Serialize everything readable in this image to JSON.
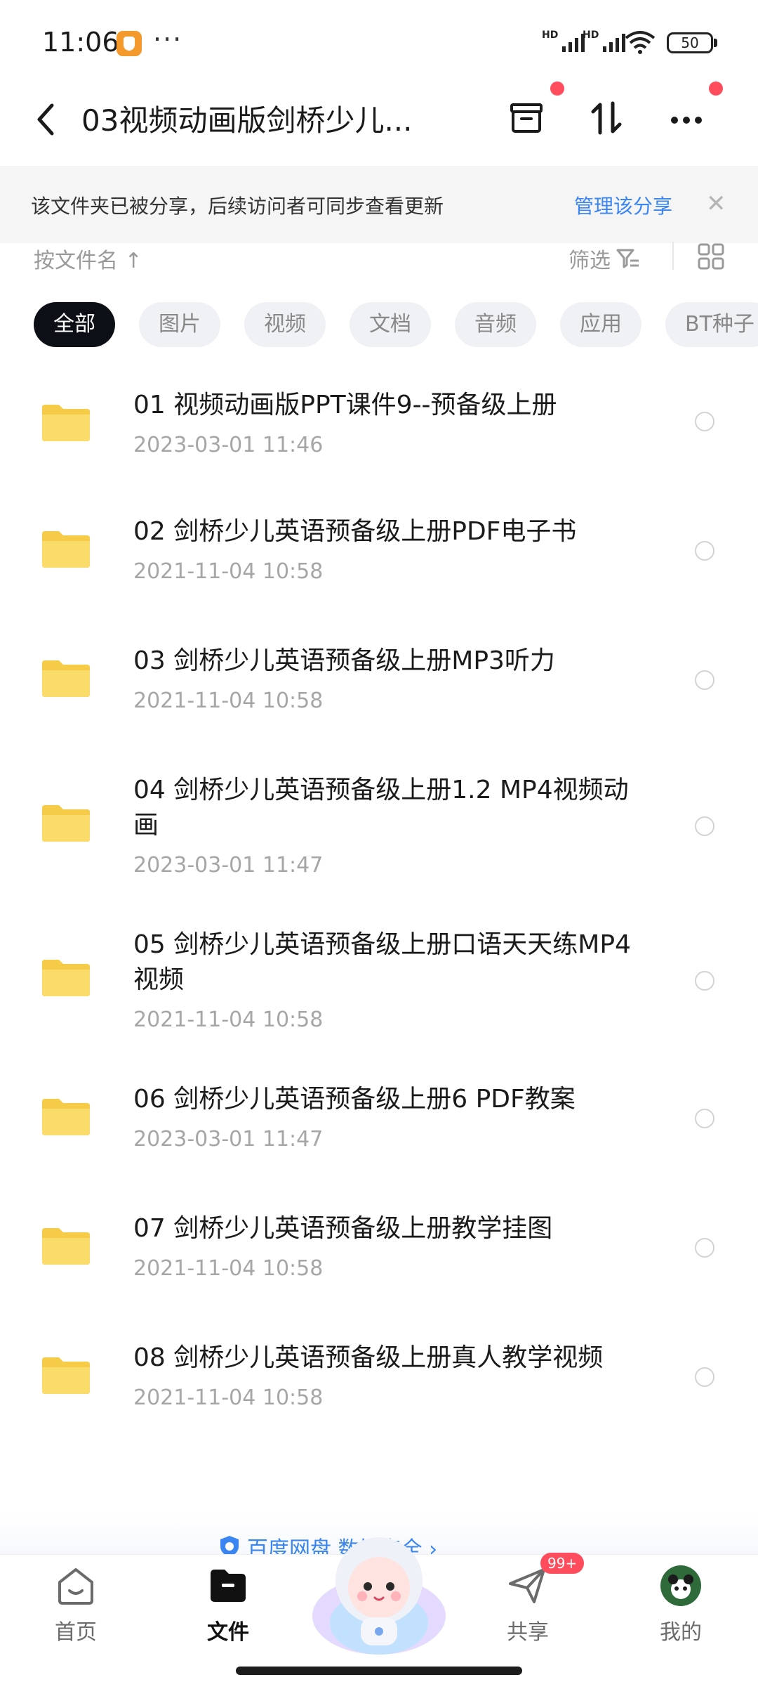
{
  "status": {
    "time": "11:06",
    "more": "···",
    "signal_label": "HD",
    "battery": "50"
  },
  "header": {
    "title": "03视频动画版剑桥少儿...",
    "icons": [
      "back-icon",
      "archive-icon",
      "sort-icon",
      "more-icon"
    ]
  },
  "banner": {
    "text": "该文件夹已被分享，后续访问者可同步查看更新",
    "link": "管理该分享",
    "close": "✕"
  },
  "toolbar": {
    "sort_label": "按文件名",
    "sort_arrow": "↑",
    "filter_label": "筛选"
  },
  "chips": [
    "全部",
    "图片",
    "视频",
    "文档",
    "音频",
    "应用",
    "BT种子"
  ],
  "files": [
    {
      "name": "01 视频动画版PPT课件9--预备级上册",
      "date": "2023-03-01  11:46"
    },
    {
      "name": "02 剑桥少儿英语预备级上册PDF电子书",
      "date": "2021-11-04  10:58"
    },
    {
      "name": "03 剑桥少儿英语预备级上册MP3听力",
      "date": "2021-11-04  10:58"
    },
    {
      "name": "04 剑桥少儿英语预备级上册1.2 MP4视频动画",
      "date": "2023-03-01  11:47"
    },
    {
      "name": "05 剑桥少儿英语预备级上册口语天天练MP4视频",
      "date": "2021-11-04  10:58"
    },
    {
      "name": "06 剑桥少儿英语预备级上册6  PDF教案",
      "date": "2023-03-01  11:47"
    },
    {
      "name": "07 剑桥少儿英语预备级上册教学挂图",
      "date": "2021-11-04  10:58"
    },
    {
      "name": "08 剑桥少儿英语预备级上册真人教学视频",
      "date": "2021-11-04  10:58"
    }
  ],
  "safety": {
    "text": "百度网盘  数据安全 ›"
  },
  "tabs": {
    "home": "首页",
    "files": "文件",
    "share": "共享",
    "share_badge": "99+",
    "mine": "我的"
  },
  "colors": {
    "accent": "#3a85f1",
    "chip_active": "#0d0f16",
    "folder": "#f9d65a",
    "red_dot": "#ff4d5e"
  }
}
